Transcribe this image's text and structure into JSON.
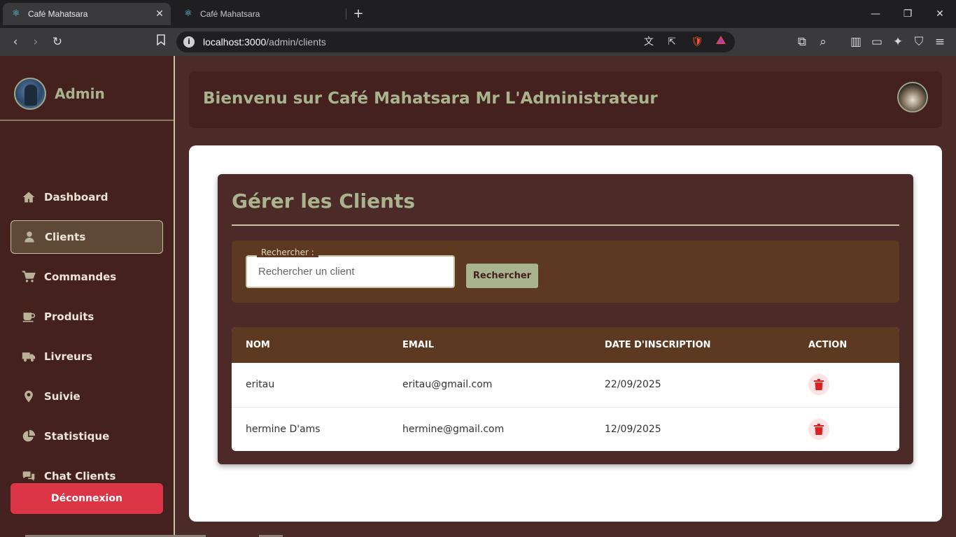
{
  "browser": {
    "tabs": [
      {
        "title": "Café Mahatsara",
        "active": true
      },
      {
        "title": "Café Mahatsara",
        "active": false
      }
    ],
    "url_host": "localhost:3000",
    "url_path": "/admin/clients"
  },
  "sidebar": {
    "brand": "Admin",
    "items": [
      {
        "label": "Dashboard",
        "icon": "home-icon"
      },
      {
        "label": "Clients",
        "icon": "user-icon",
        "active": true
      },
      {
        "label": "Commandes",
        "icon": "cart-icon"
      },
      {
        "label": "Produits",
        "icon": "mug-icon"
      },
      {
        "label": "Livreurs",
        "icon": "truck-icon"
      },
      {
        "label": "Suivie",
        "icon": "map-pin-icon"
      },
      {
        "label": "Statistique",
        "icon": "pie-chart-icon"
      },
      {
        "label": "Chat Clients",
        "icon": "chat-icon"
      }
    ],
    "logout_label": "Déconnexion"
  },
  "header": {
    "title": "Bienvenu sur Café Mahatsara Mr L'Administrateur"
  },
  "main": {
    "title": "Gérer les Clients",
    "search": {
      "label": "Rechercher :",
      "placeholder": "Rechercher un client",
      "value": "",
      "button_label": "Rechercher"
    },
    "table": {
      "columns": [
        "NOM",
        "EMAIL",
        "DATE D'INSCRIPTION",
        "ACTION"
      ],
      "rows": [
        {
          "nom": "eritau",
          "email": "eritau@gmail.com",
          "date": "22/09/2025"
        },
        {
          "nom": "hermine D'ams",
          "email": "hermine@gmail.com",
          "date": "12/09/2025"
        }
      ]
    }
  },
  "colors": {
    "sidebar_bg": "#44201f",
    "accent_sage": "#a9b48f",
    "panel_brown": "#5c3920",
    "logout_red": "#dc3545",
    "delete_red": "#e01e1e"
  }
}
